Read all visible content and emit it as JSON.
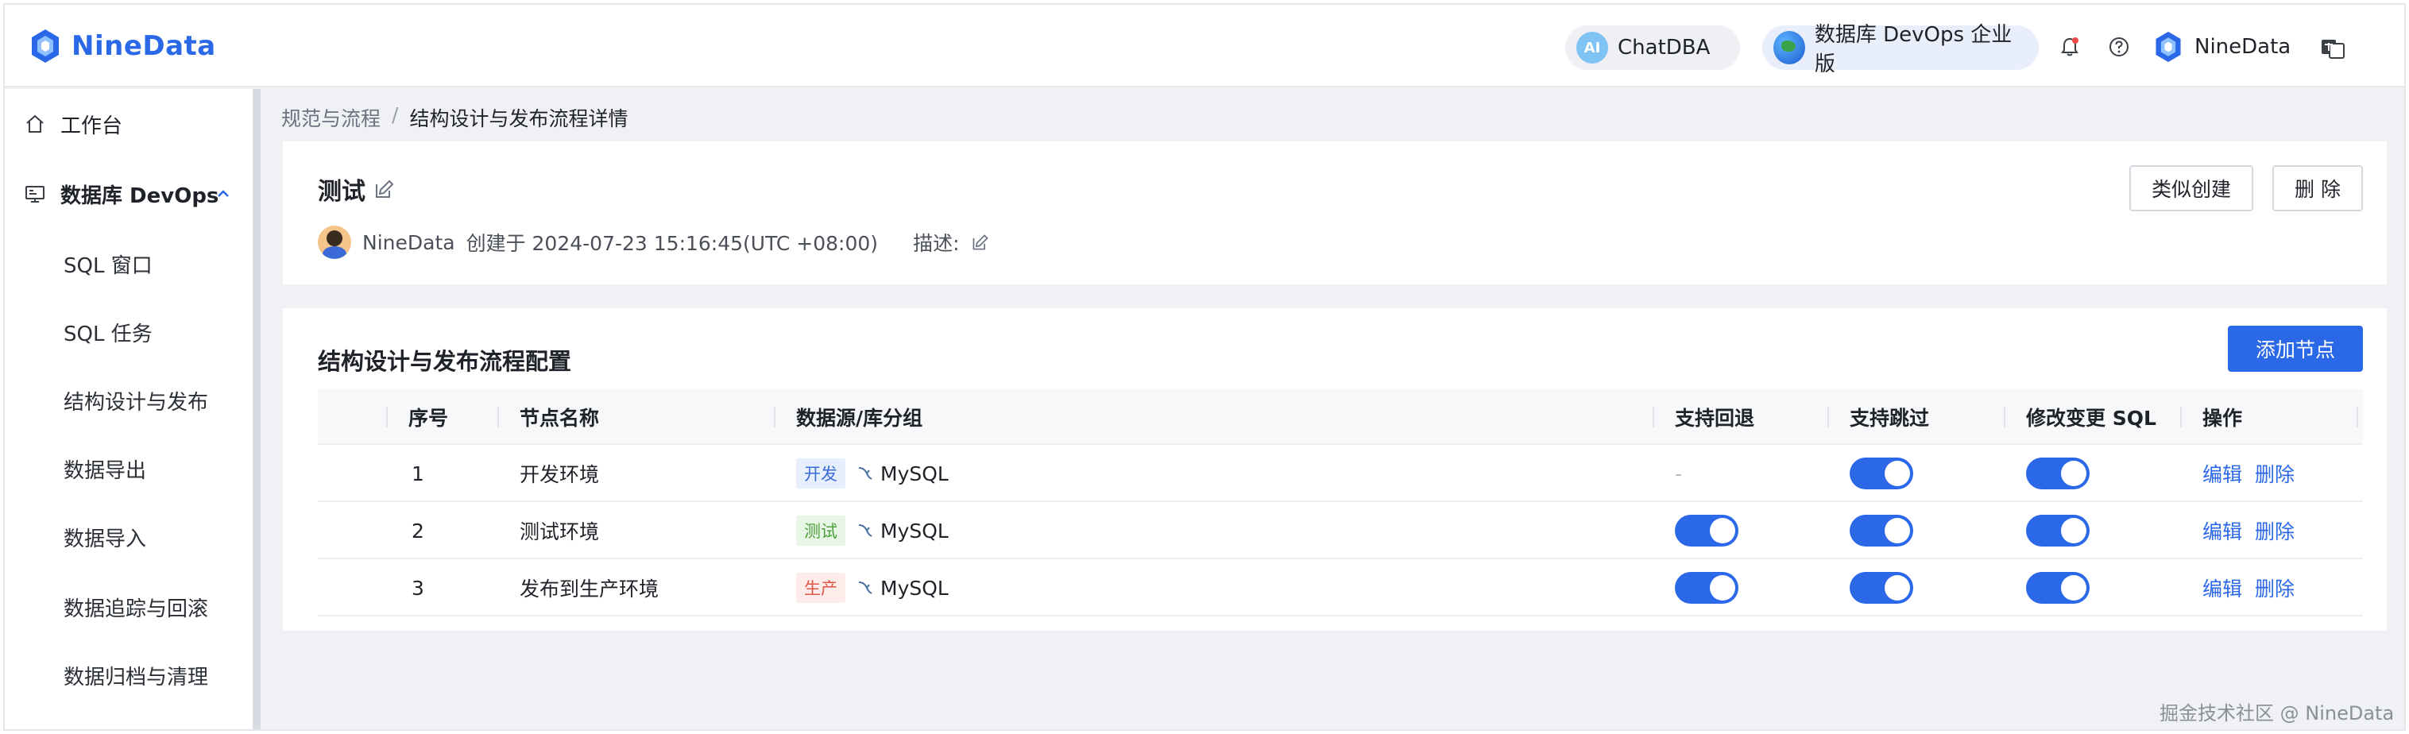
{
  "header": {
    "logo_text": "NineData",
    "chatdba_badge": "AI",
    "chatdba_label": "ChatDBA",
    "devops_label": "数据库 DevOps 企业版",
    "user_name": "NineData",
    "icons": [
      "bell-icon",
      "help-icon",
      "language-icon"
    ],
    "colors": {
      "brand": "#2a68e8"
    }
  },
  "sidebar": {
    "items": [
      {
        "label": "工作台",
        "icon": "home-icon"
      },
      {
        "label": "数据库 DevOps",
        "icon": "monitor-icon",
        "expanded": true
      },
      {
        "label": "SQL 窗口"
      },
      {
        "label": "SQL 任务"
      },
      {
        "label": "结构设计与发布"
      },
      {
        "label": "数据导出"
      },
      {
        "label": "数据导入"
      },
      {
        "label": "数据追踪与回滚"
      },
      {
        "label": "数据归档与清理"
      }
    ]
  },
  "breadcrumb": {
    "parent": "规范与流程",
    "separator": "/",
    "current": "结构设计与发布流程详情"
  },
  "detail": {
    "title": "测试",
    "creator": "NineData",
    "created_text": "创建于 2024-07-23 15:16:45(UTC +08:00)",
    "description_label": "描述:",
    "similar_button": "类似创建",
    "delete_button": "删 除"
  },
  "config": {
    "title": "结构设计与发布流程配置",
    "add_button": "添加节点",
    "columns": [
      "序号",
      "节点名称",
      "数据源/库分组",
      "支持回退",
      "支持跳过",
      "修改变更 SQL",
      "操作"
    ],
    "rows": [
      {
        "index": "1",
        "name": "开发环境",
        "env_tag": "开发",
        "env_color": "blue",
        "datasource": "MySQL",
        "rollback": null,
        "rollback_text": "-",
        "skip": true,
        "modify_sql": true,
        "edit": "编辑",
        "delete": "删除"
      },
      {
        "index": "2",
        "name": "测试环境",
        "env_tag": "测试",
        "env_color": "green",
        "datasource": "MySQL",
        "rollback": true,
        "rollback_text": "",
        "skip": true,
        "modify_sql": true,
        "edit": "编辑",
        "delete": "删除"
      },
      {
        "index": "3",
        "name": "发布到生产环境",
        "env_tag": "生产",
        "env_color": "red",
        "datasource": "MySQL",
        "rollback": true,
        "rollback_text": "",
        "skip": true,
        "modify_sql": true,
        "edit": "编辑",
        "delete": "删除"
      }
    ]
  },
  "watermark": "掘金技术社区 @ NineData"
}
